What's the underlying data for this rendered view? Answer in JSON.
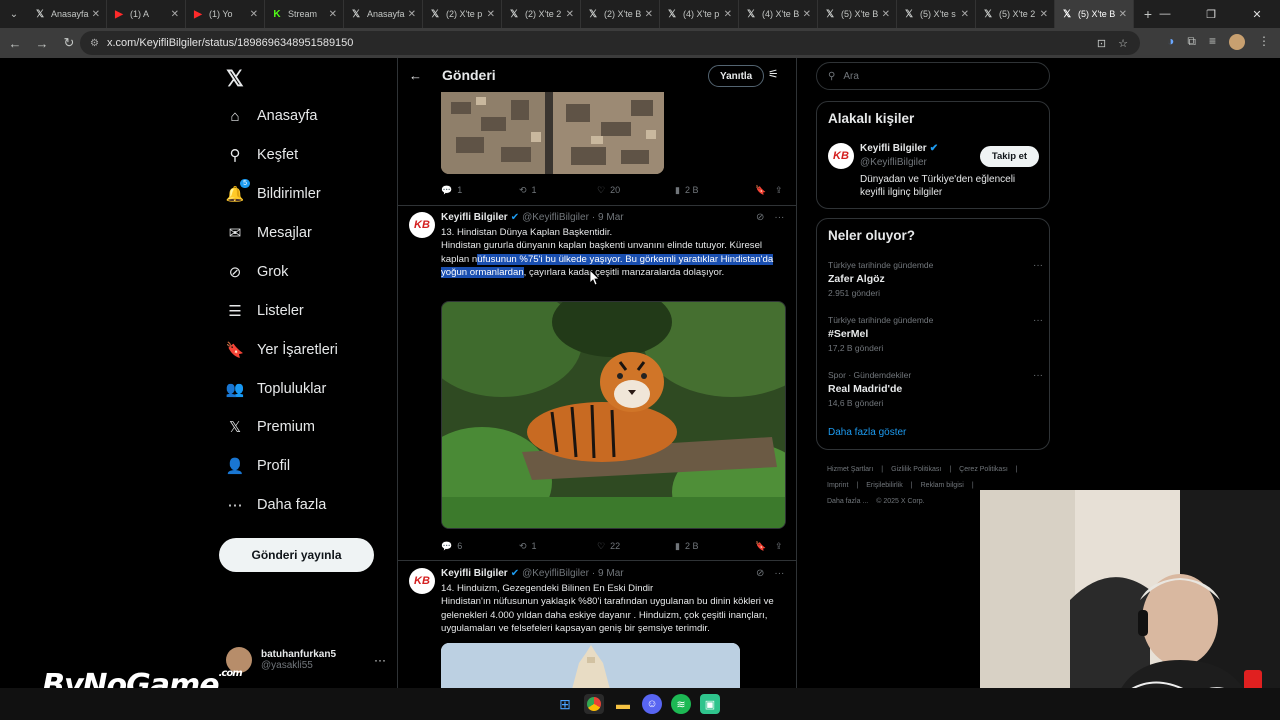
{
  "browser": {
    "tabs": [
      {
        "icon": "x",
        "label": "Anasayfa"
      },
      {
        "icon": "yt",
        "label": "(1) A"
      },
      {
        "icon": "yt",
        "label": "(1) Yo"
      },
      {
        "icon": "kick",
        "label": "Stream"
      },
      {
        "icon": "x",
        "label": "Anasayfa"
      },
      {
        "icon": "x",
        "label": "(2) X'te p"
      },
      {
        "icon": "x",
        "label": "(2) X'te 2"
      },
      {
        "icon": "x",
        "label": "(2) X'te B"
      },
      {
        "icon": "x",
        "label": "(4) X'te p"
      },
      {
        "icon": "x",
        "label": "(4) X'te B"
      },
      {
        "icon": "x",
        "label": "(5) X'te B"
      },
      {
        "icon": "x",
        "label": "(5) X'te s"
      },
      {
        "icon": "x",
        "label": "(5) X'te 2"
      },
      {
        "icon": "x",
        "label": "(5) X'te B",
        "active": true
      }
    ],
    "url": "x.com/KeyifliBilgiler/status/1898696348951589150"
  },
  "sidebar": {
    "items": [
      {
        "icon": "home-icon",
        "glyph": "⌂",
        "label": "Anasayfa"
      },
      {
        "icon": "search-icon",
        "glyph": "⚲",
        "label": "Keşfet"
      },
      {
        "icon": "bell-icon",
        "glyph": "🔔",
        "label": "Bildirimler",
        "badge": "5"
      },
      {
        "icon": "mail-icon",
        "glyph": "✉",
        "label": "Mesajlar"
      },
      {
        "icon": "grok-icon",
        "glyph": "⊘",
        "label": "Grok"
      },
      {
        "icon": "list-icon",
        "glyph": "☰",
        "label": "Listeler"
      },
      {
        "icon": "bookmark-icon",
        "glyph": "🔖",
        "label": "Yer İşaretleri"
      },
      {
        "icon": "community-icon",
        "glyph": "👥",
        "label": "Topluluklar"
      },
      {
        "icon": "x-icon",
        "glyph": "𝕏",
        "label": "Premium"
      },
      {
        "icon": "profile-icon",
        "glyph": "👤",
        "label": "Profil"
      },
      {
        "icon": "more-icon",
        "glyph": "⋯",
        "label": "Daha fazla"
      }
    ],
    "post_button": "Gönderi yayınla",
    "account": {
      "name": "batuhanfurkan5",
      "handle": "@yasakli55"
    }
  },
  "main": {
    "title": "Gönderi",
    "reply_button": "Yanıtla",
    "prev_actions": {
      "replies": "1",
      "reposts": "1",
      "likes": "20",
      "views": "2 B"
    },
    "tweets": [
      {
        "name": "Keyifli Bilgiler",
        "handle": "@KeyifliBilgiler",
        "date": "· 9 Mar",
        "title_line": "13. Hindistan Dünya Kaplan Başkentidir.",
        "text_before": "Hindistan gururla dünyanın kaplan başkenti unvanını elinde tutuyor. Küresel kaplan n",
        "text_highlight": "üfusunun %75'i bu ülkede yaşıyor. Bu görkemli yaratıklar Hindistan'da yoğun ormanlardan",
        "text_after": ", çayırlara kadar çeşitli manzaralarda dolaşıyor.",
        "actions": {
          "replies": "6",
          "reposts": "1",
          "likes": "22",
          "views": "2 B"
        }
      },
      {
        "name": "Keyifli Bilgiler",
        "handle": "@KeyifliBilgiler",
        "date": "· 9 Mar",
        "title_line": "14. Hinduizm, Gezegendeki Bilinen En Eski Dindir",
        "text": "Hindistan'ın nüfusunun yaklaşık %80'i tarafından uygulanan bu dinin kökleri ve gelenekleri 4.000 yıldan daha eskiye dayanır . Hinduizm, çok çeşitli inançları, uygulamaları ve felsefeleri kapsayan geniş bir şemsiye terimdir."
      }
    ]
  },
  "right": {
    "search_placeholder": "Ara",
    "related": {
      "title": "Alakalı kişiler",
      "name": "Keyifli Bilgiler",
      "handle": "@KeyifliBilgiler",
      "follow": "Takip et",
      "bio": "Dünyadan ve Türkiye'den eğlenceli keyifli ilginç bilgiler"
    },
    "trends": {
      "title": "Neler oluyor?",
      "items": [
        {
          "category": "Türkiye tarihinde gündemde",
          "name": "Zafer Algöz",
          "count": "2.951 gönderi"
        },
        {
          "category": "Türkiye tarihinde gündemde",
          "name": "#SerMel",
          "count": "17,2 B gönderi"
        },
        {
          "category": "Spor · Gündemdekiler",
          "name": "Real Madrid'de",
          "count": "14,6 B gönderi"
        }
      ],
      "show_more": "Daha fazla göster"
    },
    "footer": [
      "Hizmet Şartları",
      "|",
      "Gizlilik Politikası",
      "|",
      "Çerez Politikası",
      "|",
      "Imprint",
      "|",
      "Erişilebilirlik",
      "|",
      "Reklam bilgisi",
      "|",
      "Daha fazla ...",
      "© 2025 X Corp."
    ]
  },
  "avatar_text": "KB",
  "watermark": {
    "text": "ByNoGame",
    "suffix": ".com"
  },
  "colors": {
    "accent": "#1d9bf0",
    "highlight": "#1a4fb0",
    "background": "#000000",
    "border": "#2f3336"
  }
}
